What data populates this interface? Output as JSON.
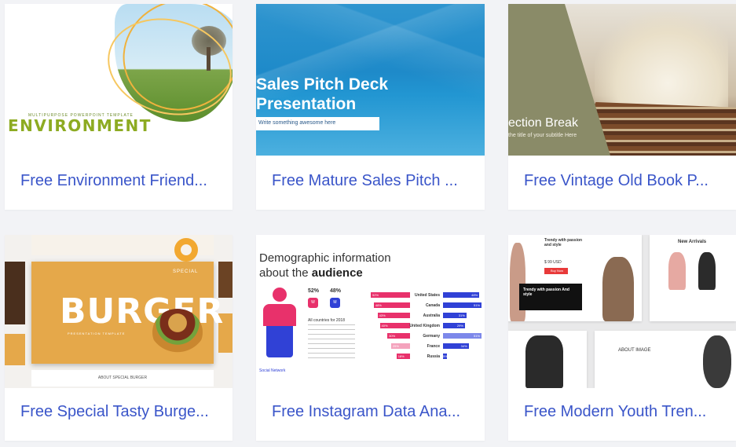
{
  "cards": [
    {
      "title": "Free Environment Friend...",
      "thumb": {
        "subtitle": "MULTIPURPOSE POWERPOINT TEMPLATE",
        "word": "ENVIRONMENT"
      }
    },
    {
      "title": "Free Mature Sales Pitch ...",
      "thumb": {
        "heading_line1": "Sales Pitch Deck",
        "heading_line2": "Presentation",
        "input_text": "Write something awesome here"
      }
    },
    {
      "title": "Free Vintage Old Book P...",
      "thumb": {
        "heading": "ection Break",
        "subtitle": "the title of your subtitle Here"
      }
    },
    {
      "title": "Free Special Tasty Burge...",
      "thumb": {
        "word": "BURGER",
        "special": "SPECIAL",
        "sub": "PRESENTATION TEMPLATE",
        "about": "ABOUT SPECIAL BURGER"
      }
    },
    {
      "title": "Free Instagram Data Ana...",
      "thumb": {
        "heading_line1": "Demographic information",
        "heading_prefix": "about the ",
        "heading_bold": "audience",
        "pct_left": "52%",
        "pct_right": "48%",
        "icon_left": "W",
        "icon_right": "M",
        "caption": "All countries for 2018",
        "logo": "Social Network",
        "rows": [
          {
            "country": "United States",
            "left": "52%",
            "right": "48%"
          },
          {
            "country": "Canada",
            "left": "48%",
            "right": "51%"
          },
          {
            "country": "Australia",
            "left": "43%",
            "right": "31%"
          },
          {
            "country": "United Kingdom",
            "left": "40%",
            "right": "29%"
          },
          {
            "country": "Germany",
            "left": "30%",
            "right": "51%"
          },
          {
            "country": "France",
            "left": "25%",
            "right": "34%"
          },
          {
            "country": "Russia",
            "left": "18%",
            "right": "5%"
          }
        ]
      }
    },
    {
      "title": "Free Modern Youth Tren...",
      "thumb": {
        "trendy1": "Trendy with passion and style",
        "price": "$ 99 USD",
        "button": "Buy Now",
        "trendy2": "Trendy with passion And style",
        "new_arrivals": "New Arrivals",
        "about_image": "ABOUT IMAGE"
      }
    }
  ],
  "colors": {
    "title": "#3a55c9",
    "page_bg": "#f2f3f6"
  }
}
